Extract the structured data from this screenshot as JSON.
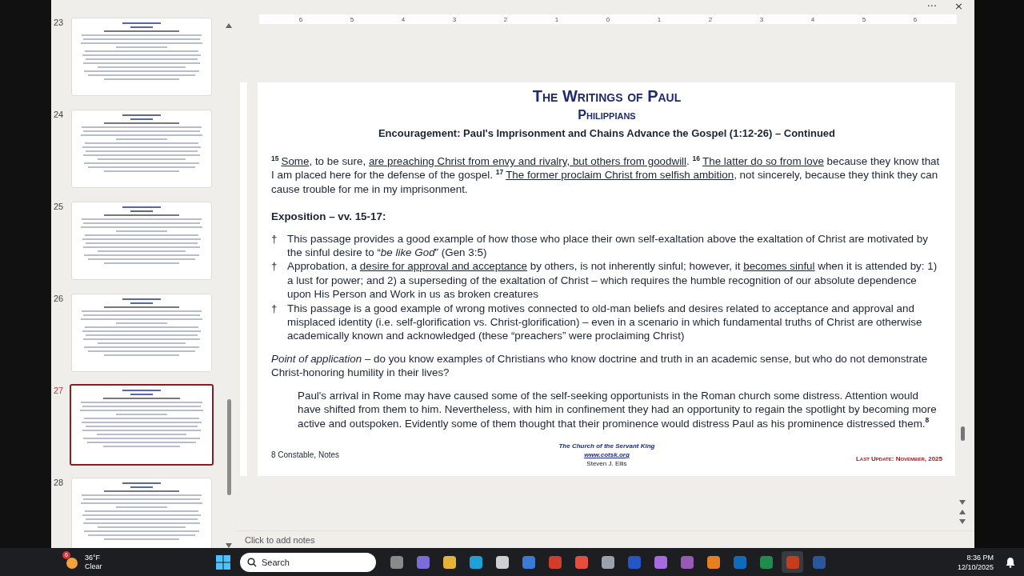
{
  "window": {
    "menu": "···",
    "close": "×"
  },
  "ruler": [
    "6",
    "5",
    "4",
    "3",
    "2",
    "1",
    "0",
    "1",
    "2",
    "3",
    "4",
    "5",
    "6"
  ],
  "thumbnails": [
    {
      "number": "23",
      "selected": false
    },
    {
      "number": "24",
      "selected": false
    },
    {
      "number": "25",
      "selected": false
    },
    {
      "number": "26",
      "selected": false
    },
    {
      "number": "27",
      "selected": true
    },
    {
      "number": "28",
      "selected": false
    }
  ],
  "slide": {
    "title": "The Writings of Paul",
    "subtitle": "Philippians",
    "heading": "Encouragement:  Paul's Imprisonment and Chains Advance the Gospel (1:12-26) – Continued",
    "scripture": [
      {
        "kind": "sup",
        "text": "15"
      },
      {
        "kind": "underline",
        "text": "Some"
      },
      {
        "kind": "plain",
        "text": ", to be sure, "
      },
      {
        "kind": "underline",
        "text": "are preaching Christ from envy and rivalry, but others from goodwill"
      },
      {
        "kind": "plain",
        "text": ". "
      },
      {
        "kind": "sup",
        "text": "16"
      },
      {
        "kind": "underline",
        "text": "The latter do so from love"
      },
      {
        "kind": "plain",
        "text": " because they know that I am placed here for the defense of the gospel. "
      },
      {
        "kind": "sup",
        "text": "17"
      },
      {
        "kind": "underline",
        "text": "The former proclaim Christ from selfish ambition"
      },
      {
        "kind": "plain",
        "text": ", not sincerely, because they think they can cause trouble for me in my imprisonment."
      }
    ],
    "exposition_heading": "Exposition – vv. 15-17:",
    "bullets": [
      {
        "marker": "†",
        "segments": [
          {
            "kind": "plain",
            "text": "This passage provides a good example of how those who place their own self-exaltation above the exaltation of Christ are motivated by the sinful desire to “"
          },
          {
            "kind": "italic",
            "text": "be like God"
          },
          {
            "kind": "plain",
            "text": "” (Gen 3:5)"
          }
        ]
      },
      {
        "marker": "†",
        "segments": [
          {
            "kind": "plain",
            "text": "Approbation, a "
          },
          {
            "kind": "underline",
            "text": "desire for approval and acceptance"
          },
          {
            "kind": "plain",
            "text": " by others, is not inherently sinful; however, it "
          },
          {
            "kind": "underline",
            "text": "becomes sinful"
          },
          {
            "kind": "plain",
            "text": " when it is attended by: 1) a lust for power; and 2) a superseding of the exaltation of Christ – which requires the humble recognition of our absolute dependence upon His Person and Work in us as broken creatures"
          }
        ]
      },
      {
        "marker": "†",
        "segments": [
          {
            "kind": "plain",
            "text": "This passage is a good example of wrong motives connected to old-man beliefs and desires related to acceptance and approval and misplaced identity (i.e. self-glorification vs. Christ-glorification) – even in a scenario in which fundamental truths of Christ are otherwise academically known and acknowledged (these “preachers” were proclaiming Christ)"
          }
        ]
      }
    ],
    "application": [
      {
        "kind": "italic",
        "text": "Point of application"
      },
      {
        "kind": "plain",
        "text": " – do you know examples of Christians who know doctrine and truth in an academic sense, but who do not demonstrate Christ-honoring humility in their lives?"
      }
    ],
    "quote": [
      {
        "kind": "plain",
        "text": "Paul's arrival in Rome may have caused some of the self-seeking opportunists in the Roman church some distress. Attention would have shifted from them to him. Nevertheless, with him in confinement they had an opportunity to regain the spotlight by becoming more active and outspoken. Evidently some of them thought that their prominence would distress Paul as his prominence distressed them."
      },
      {
        "kind": "sup",
        "text": "8"
      }
    ],
    "footnote": "8  Constable, Notes",
    "footer": {
      "church": "The Church of the Servant King",
      "website": "www.cotsk.org",
      "author": "Steven J. Ellis",
      "update": "Last Update:  November, 2025"
    }
  },
  "notes": {
    "placeholder": "Click to add notes"
  },
  "taskbar": {
    "weather": {
      "badge": "6",
      "temperature": "36°F",
      "condition": "Clear"
    },
    "search": {
      "placeholder": "Search"
    },
    "apps": [
      {
        "selected": false
      },
      {
        "selected": false
      },
      {
        "selected": false
      },
      {
        "selected": false
      },
      {
        "selected": false
      },
      {
        "selected": false
      },
      {
        "selected": false
      },
      {
        "selected": false
      },
      {
        "selected": false
      },
      {
        "selected": false
      },
      {
        "selected": false
      },
      {
        "selected": false
      },
      {
        "selected": false
      },
      {
        "selected": false
      },
      {
        "selected": false
      },
      {
        "selected": true
      },
      {
        "selected": false
      }
    ],
    "time": "8:36 PM",
    "date": "12/10/2025"
  }
}
